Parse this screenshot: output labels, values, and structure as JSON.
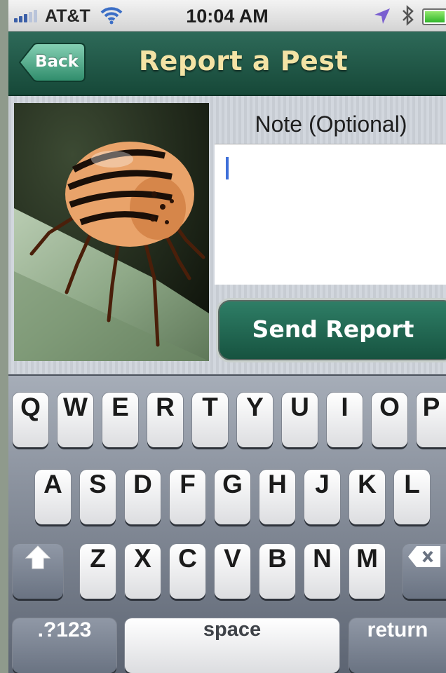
{
  "status_bar": {
    "carrier": "AT&T",
    "time": "10:04 AM",
    "icons": [
      "signal-icon",
      "wifi-icon",
      "location-arrow-icon",
      "bluetooth-icon",
      "battery-icon"
    ]
  },
  "nav": {
    "back_label": "Back",
    "title": "Report a Pest"
  },
  "form": {
    "note_label": "Note (Optional)",
    "note_value": "",
    "send_label": "Send Report",
    "photo_icon": "colorado-potato-beetle-photo"
  },
  "keyboard": {
    "row1": [
      "Q",
      "W",
      "E",
      "R",
      "T",
      "Y",
      "U",
      "I",
      "O",
      "P"
    ],
    "row2": [
      "A",
      "S",
      "D",
      "F",
      "G",
      "H",
      "J",
      "K",
      "L"
    ],
    "row3": [
      "Z",
      "X",
      "C",
      "V",
      "B",
      "N",
      "M"
    ],
    "numbers_label": ".?123",
    "space_label": "space",
    "return_label": "return",
    "shift_icon": "shift-arrow-icon",
    "delete_icon": "backspace-icon"
  },
  "colors": {
    "nav_green": "#1e5646",
    "title_cream": "#f3e3a5",
    "caret_blue": "#3d6fd9"
  }
}
